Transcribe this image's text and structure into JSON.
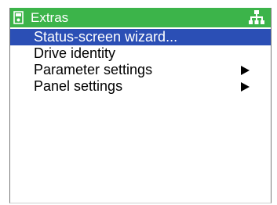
{
  "header": {
    "title": "Extras",
    "left_icon": "operator-panel-icon",
    "right_icon": "menu-tree-icon",
    "background_color": "#3cb44a"
  },
  "menu": {
    "selected_color": "#2b4fb5",
    "items": [
      {
        "label": "Status-screen wizard...",
        "selected": true,
        "has_submenu": false
      },
      {
        "label": "Drive identity",
        "selected": false,
        "has_submenu": false
      },
      {
        "label": "Parameter settings",
        "selected": false,
        "has_submenu": true
      },
      {
        "label": "Panel settings",
        "selected": false,
        "has_submenu": true
      }
    ]
  }
}
